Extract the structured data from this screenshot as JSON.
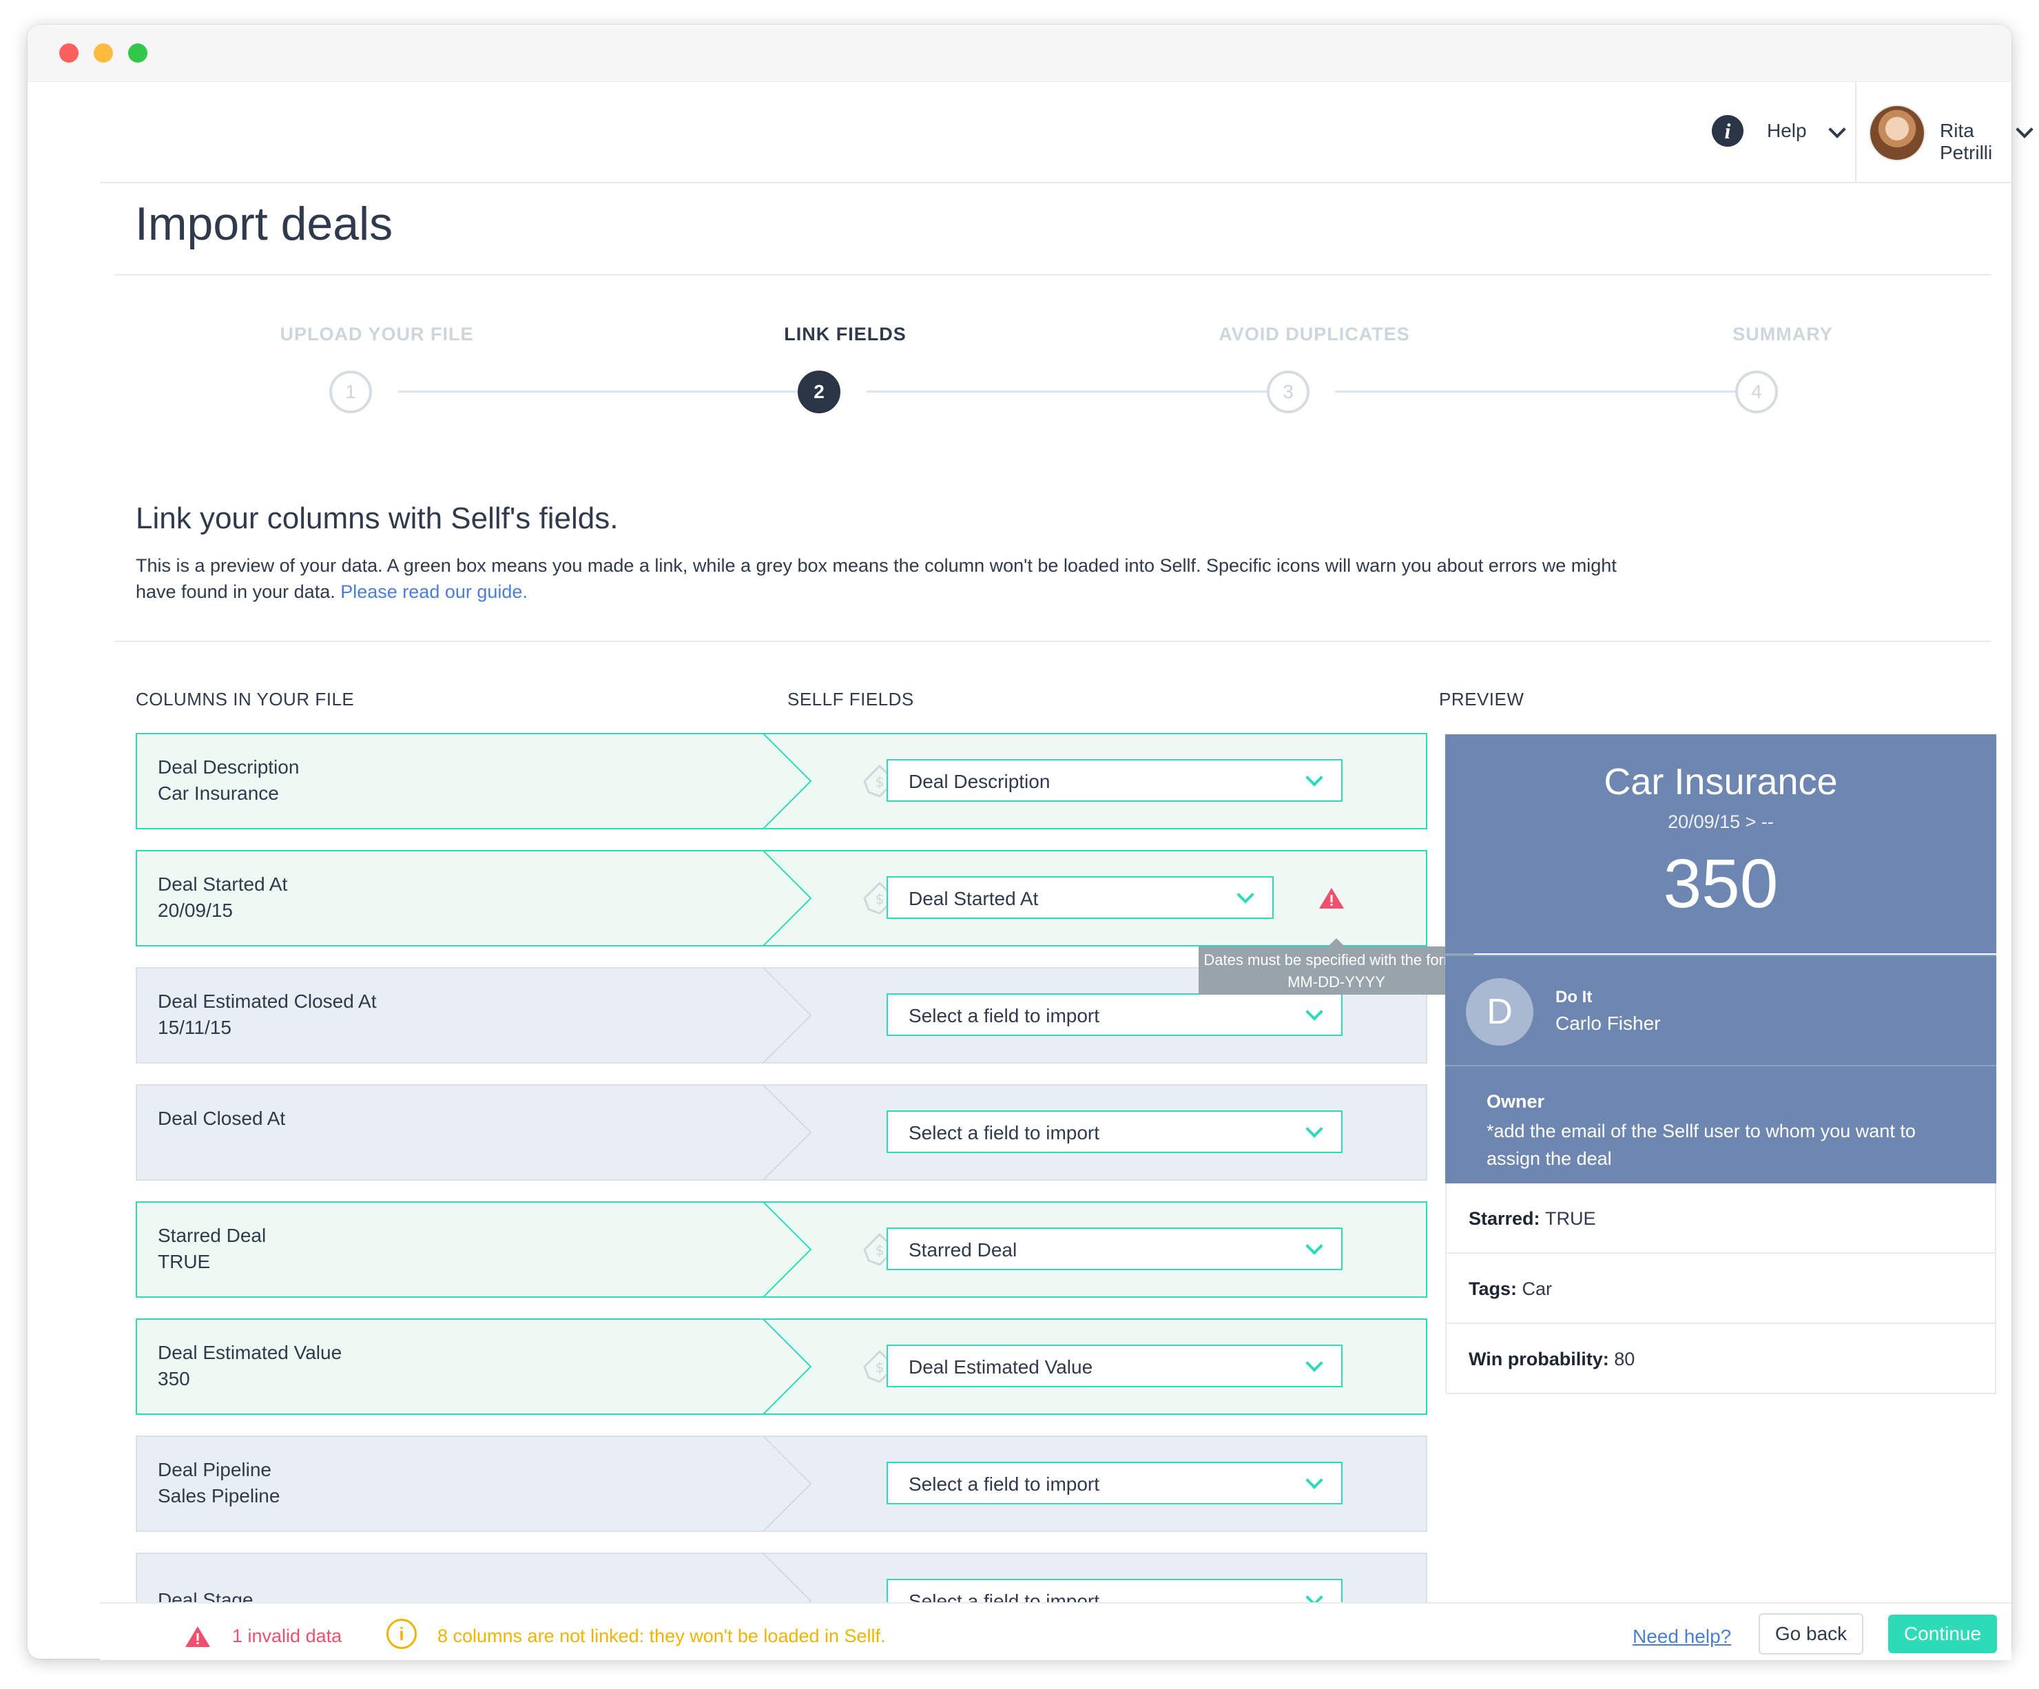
{
  "topbar": {
    "help_label": "Help",
    "user_name": "Rita Petrilli"
  },
  "page": {
    "title": "Import deals"
  },
  "steps": [
    {
      "label": "UPLOAD YOUR FILE",
      "number": "1"
    },
    {
      "label": "LINK FIELDS",
      "number": "2"
    },
    {
      "label": "AVOID DUPLICATES",
      "number": "3"
    },
    {
      "label": "SUMMARY",
      "number": "4"
    }
  ],
  "section": {
    "title": "Link your columns with Sellf's fields.",
    "description": "This is a preview of your data. A green box means you made a link, while a grey box means the column won't be loaded into Sellf. Specific icons will warn you about errors we might have found in your data.",
    "guide_link": "Please read our guide."
  },
  "columns": {
    "file": "COLUMNS IN YOUR FILE",
    "fields": "SELLF FIELDS",
    "preview": "PREVIEW"
  },
  "rows": [
    {
      "name": "Deal Description",
      "value": "Car Insurance",
      "field": "Deal Description",
      "linked": true
    },
    {
      "name": "Deal Started At",
      "value": "20/09/15",
      "field": "Deal Started At",
      "linked": true
    },
    {
      "name": "Deal Estimated Closed At",
      "value": "15/11/15",
      "field": "Select a field to import",
      "linked": false
    },
    {
      "name": "Deal Closed At",
      "value": "",
      "field": "Select a field to import",
      "linked": false
    },
    {
      "name": "Starred Deal",
      "value": "TRUE",
      "field": "Starred Deal",
      "linked": true
    },
    {
      "name": "Deal Estimated Value",
      "value": "350",
      "field": "Deal Estimated Value",
      "linked": true
    },
    {
      "name": "Deal Pipeline",
      "value": "Sales Pipeline",
      "field": "Select a field to import",
      "linked": false
    },
    {
      "name": "Deal Stage",
      "value": "",
      "field": "Select a field to import",
      "linked": false
    }
  ],
  "tooltip": {
    "text": "Dates must be specified with the format MM-DD-YYYY"
  },
  "preview": {
    "title": "Car Insurance",
    "date": "20/09/15 > --",
    "value": "350",
    "action_initial": "D",
    "action_title": "Do It",
    "action_user": "Carlo Fisher",
    "owner_title": "Owner",
    "owner_note": "*add the email of the Sellf user to whom you want to assign the deal",
    "starred_label": "Starred:",
    "starred_value": "TRUE",
    "tags_label": "Tags:",
    "tags_value": "Car",
    "win_label": "Win probability:",
    "win_value": "80"
  },
  "footer": {
    "invalid": "1 invalid data",
    "info_glyph": "i",
    "unlinked": "8 columns are not linked: they won't be loaded in Sellf.",
    "need_help": "Need help?",
    "go_back": "Go back",
    "continue": "Continue"
  },
  "colors": {
    "accent": "#2ddbb8",
    "preview_bg": "#6e87b1",
    "error": "#f0506e",
    "warning": "#f0b400",
    "dark": "#2b3546"
  },
  "icons": {
    "info": "i"
  }
}
